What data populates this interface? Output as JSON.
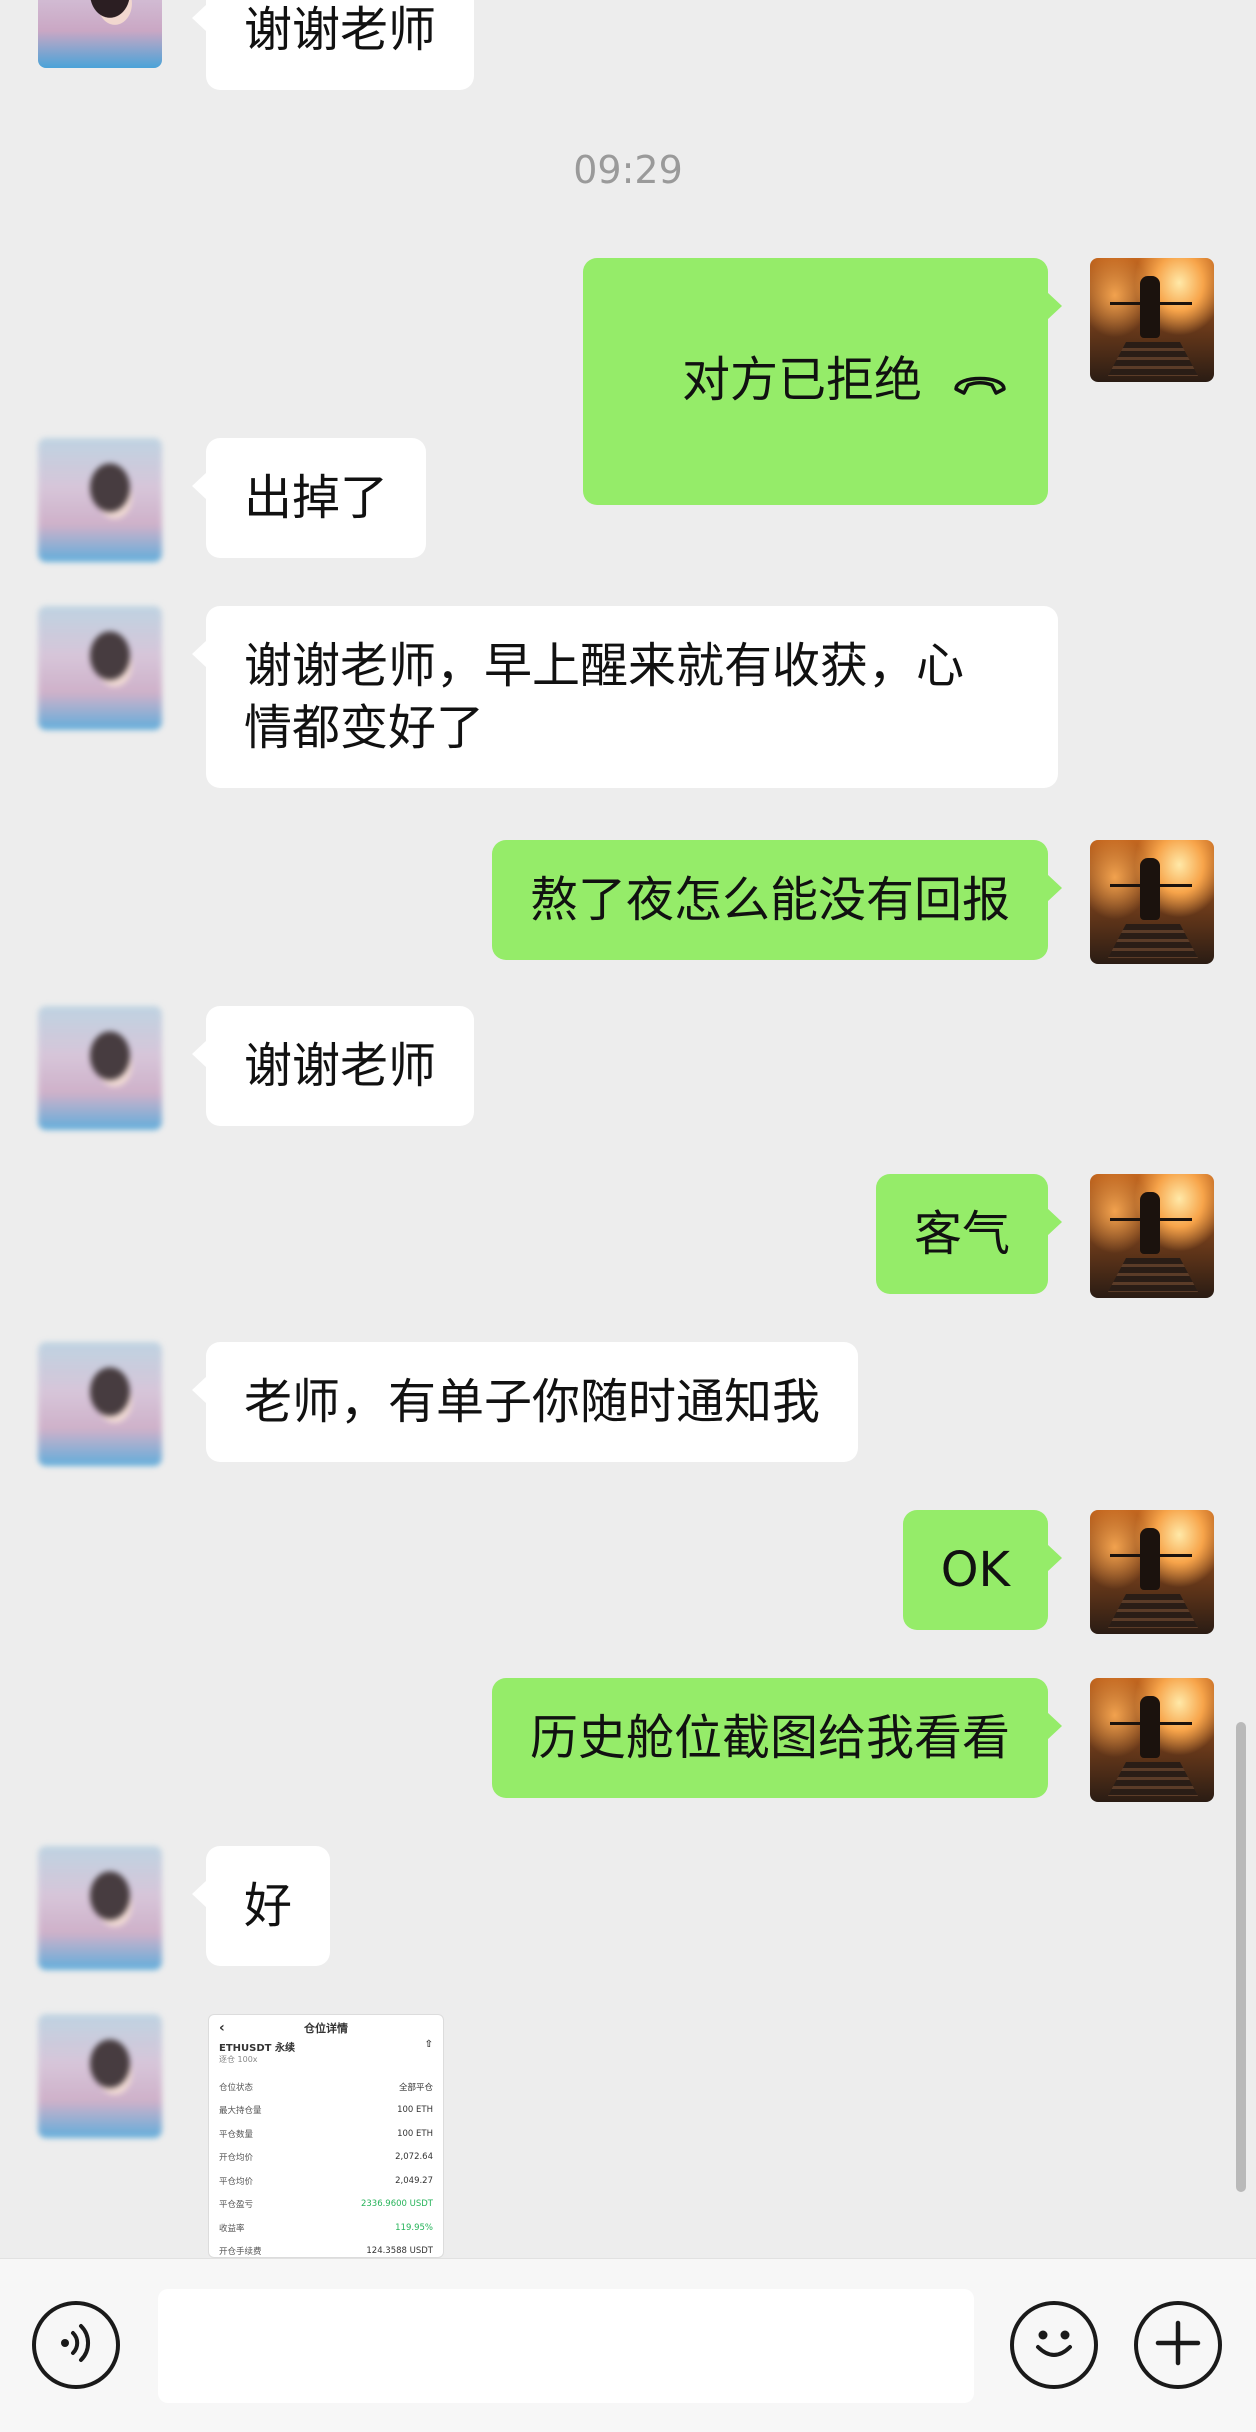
{
  "timestamp": "09:29",
  "messages": [
    {
      "side": "in",
      "text": "谢谢老师"
    },
    {
      "side": "out",
      "text": "对方已拒绝",
      "icon": "call-declined-icon"
    },
    {
      "side": "in",
      "text": "出掉了"
    },
    {
      "side": "in",
      "text": "谢谢老师，早上醒来就有收获，心\n情都变好了"
    },
    {
      "side": "out",
      "text": "熬了夜怎么能没有回报"
    },
    {
      "side": "in",
      "text": "谢谢老师"
    },
    {
      "side": "out",
      "text": "客气"
    },
    {
      "side": "in",
      "text": "老师，有单子你随时通知我"
    },
    {
      "side": "out",
      "text": "OK"
    },
    {
      "side": "out",
      "text": "历史舱位截图给我看看"
    },
    {
      "side": "in",
      "text": "好"
    }
  ],
  "image_message": {
    "header": "仓位详情",
    "back": "‹",
    "pair": "ETHUSDT 永续",
    "share_icon": "share-icon",
    "sub": "逐仓 100x",
    "rows": [
      {
        "label": "仓位状态",
        "value": "全部平仓"
      },
      {
        "label": "最大持仓量",
        "value": "100 ETH"
      },
      {
        "label": "平仓数量",
        "value": "100 ETH"
      },
      {
        "label": "开仓均价",
        "value": "2,072.64"
      },
      {
        "label": "平仓均价",
        "value": "2,049.27"
      },
      {
        "label": "平仓盈亏",
        "value": "2336.9600 USDT",
        "color": "#27b35a"
      },
      {
        "label": "收益率",
        "value": "119.95%",
        "color": "#27b35a"
      },
      {
        "label": "开仓手续费",
        "value": "124.3588 USDT"
      }
    ]
  },
  "input_bar": {
    "voice_icon": "voice-icon",
    "emoji_icon": "emoji-icon",
    "plus_icon": "plus-icon",
    "input_value": ""
  },
  "colors": {
    "background": "#ededed",
    "outgoing_bubble": "#95ec69",
    "incoming_bubble": "#ffffff",
    "profit_green": "#27b35a"
  }
}
